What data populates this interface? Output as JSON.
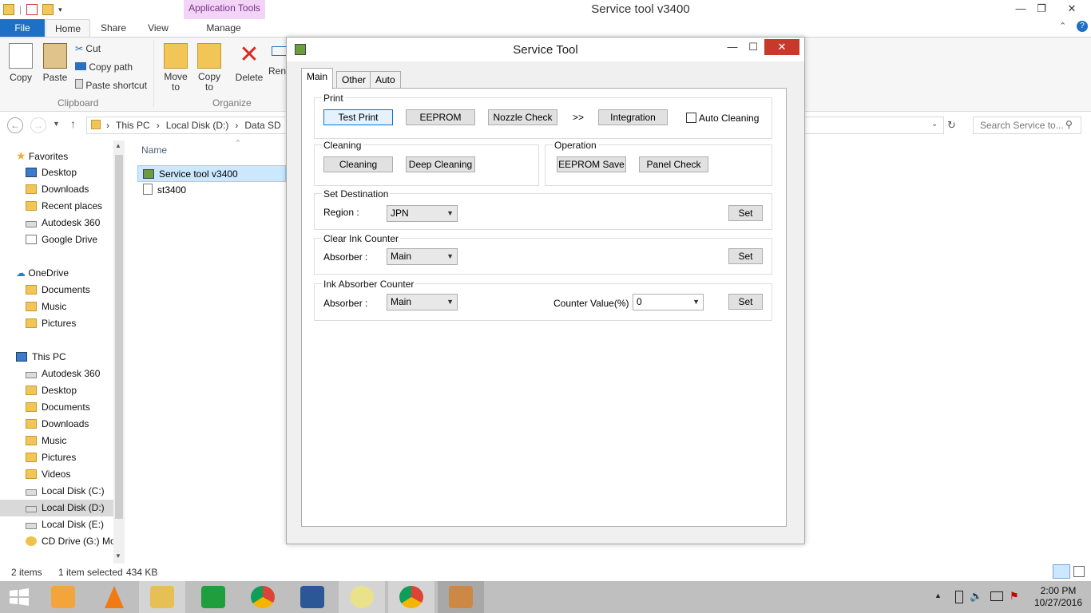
{
  "window": {
    "title": "Service tool v3400",
    "app_tools_tab": "Application Tools"
  },
  "ribbon": {
    "tabs": {
      "file": "File",
      "home": "Home",
      "share": "Share",
      "view": "View",
      "manage": "Manage"
    },
    "copy": "Copy",
    "paste": "Paste",
    "cut": "Cut",
    "copy_path": "Copy path",
    "paste_shortcut": "Paste shortcut",
    "clipboard_group": "Clipboard",
    "move_to": "Move to",
    "copy_to": "Copy to",
    "delete": "Delete",
    "rename": "Rena",
    "organize_group": "Organize"
  },
  "nav": {
    "breadcrumb": [
      "This PC",
      "Local Disk (D:)",
      "Data SD"
    ],
    "search_placeholder": "Search Service to..."
  },
  "navpane": {
    "favorites": "Favorites",
    "fav_items": [
      "Desktop",
      "Downloads",
      "Recent places",
      "Autodesk 360",
      "Google Drive"
    ],
    "onedrive": "OneDrive",
    "onedrive_items": [
      "Documents",
      "Music",
      "Pictures"
    ],
    "thispc": "This PC",
    "pc_items": [
      "Autodesk 360",
      "Desktop",
      "Documents",
      "Downloads",
      "Music",
      "Pictures",
      "Videos",
      "Local Disk (C:)",
      "Local Disk (D:)",
      "Local Disk (E:)",
      "CD Drive (G:) Mo"
    ]
  },
  "filelist": {
    "column_name": "Name",
    "files": [
      "Service tool v3400",
      "st3400"
    ]
  },
  "status": {
    "items": "2 items",
    "selected": "1 item selected",
    "size": "434 KB"
  },
  "clock": {
    "time": "2:00 PM",
    "date": "10/27/2016"
  },
  "dialog": {
    "title": "Service Tool",
    "tabs": [
      "Main",
      "Other",
      "Auto"
    ],
    "print": {
      "label": "Print",
      "test_print": "Test Print",
      "eeprom": "EEPROM",
      "nozzle_check": "Nozzle Check",
      "arrows": ">>",
      "integration": "Integration",
      "auto_cleaning": "Auto Cleaning"
    },
    "cleaning": {
      "label": "Cleaning",
      "cleaning_btn": "Cleaning",
      "deep_cleaning": "Deep Cleaning"
    },
    "operation": {
      "label": "Operation",
      "eeprom_save": "EEPROM Save",
      "panel_check": "Panel Check"
    },
    "destination": {
      "label": "Set Destination",
      "region_label": "Region :",
      "region_value": "JPN",
      "set": "Set"
    },
    "clear_ink": {
      "label": "Clear Ink Counter",
      "absorber_label": "Absorber :",
      "absorber_value": "Main",
      "set": "Set"
    },
    "ink_absorber": {
      "label": "Ink Absorber Counter",
      "absorber_label": "Absorber :",
      "absorber_value": "Main",
      "counter_label": "Counter Value(%) :",
      "counter_value": "0",
      "set": "Set"
    }
  }
}
